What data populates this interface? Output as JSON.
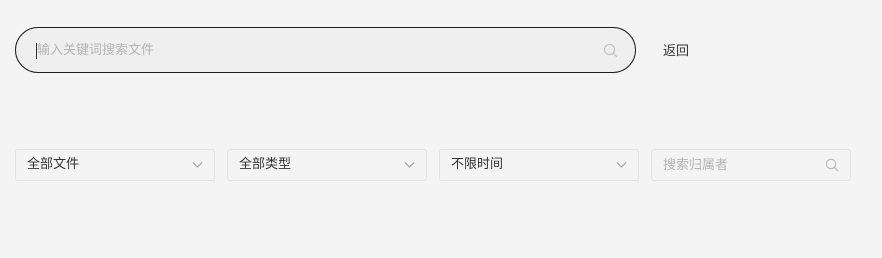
{
  "search": {
    "placeholder": "输入关键词搜索文件",
    "value": "",
    "icon": "search-icon"
  },
  "back_label": "返回",
  "filters": {
    "file_scope": {
      "label": "全部文件",
      "icon": "chevron-down-icon"
    },
    "file_type": {
      "label": "全部类型",
      "icon": "chevron-down-icon"
    },
    "time_range": {
      "label": "不限时间",
      "icon": "chevron-down-icon"
    },
    "owner_search": {
      "placeholder": "搜索归属者",
      "value": "",
      "icon": "search-icon"
    }
  }
}
